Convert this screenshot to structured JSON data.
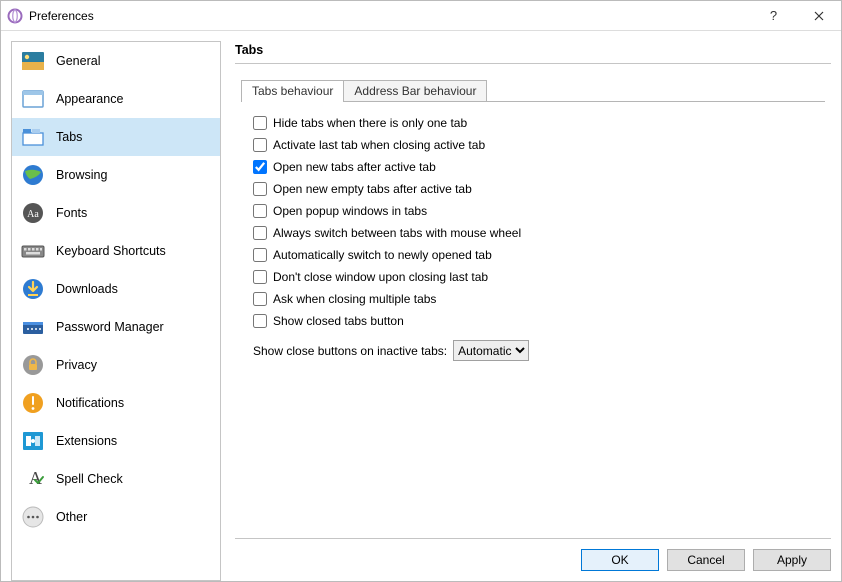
{
  "window": {
    "title": "Preferences"
  },
  "sidebar": {
    "items": [
      {
        "id": "general",
        "label": "General"
      },
      {
        "id": "appearance",
        "label": "Appearance"
      },
      {
        "id": "tabs",
        "label": "Tabs"
      },
      {
        "id": "browsing",
        "label": "Browsing"
      },
      {
        "id": "fonts",
        "label": "Fonts"
      },
      {
        "id": "shortcuts",
        "label": "Keyboard Shortcuts"
      },
      {
        "id": "downloads",
        "label": "Downloads"
      },
      {
        "id": "password",
        "label": "Password Manager"
      },
      {
        "id": "privacy",
        "label": "Privacy"
      },
      {
        "id": "notifications",
        "label": "Notifications"
      },
      {
        "id": "extensions",
        "label": "Extensions"
      },
      {
        "id": "spellcheck",
        "label": "Spell Check"
      },
      {
        "id": "other",
        "label": "Other"
      }
    ],
    "selected": "tabs"
  },
  "main": {
    "heading": "Tabs",
    "tabs": [
      {
        "id": "tabs-behaviour",
        "label": "Tabs behaviour",
        "active": true
      },
      {
        "id": "address-behaviour",
        "label": "Address Bar behaviour",
        "active": false
      }
    ],
    "options": [
      {
        "id": "hideTabs",
        "label": "Hide tabs when there is only one tab",
        "checked": false
      },
      {
        "id": "activateLast",
        "label": "Activate last tab when closing active tab",
        "checked": false
      },
      {
        "id": "openAfter",
        "label": "Open new tabs after active tab",
        "checked": true
      },
      {
        "id": "openEmpty",
        "label": "Open new empty tabs after active tab",
        "checked": false
      },
      {
        "id": "popup",
        "label": "Open popup windows in tabs",
        "checked": false
      },
      {
        "id": "wheelSwitch",
        "label": "Always switch between tabs with mouse wheel",
        "checked": false
      },
      {
        "id": "autoSwitch",
        "label": "Automatically switch to newly opened tab",
        "checked": false
      },
      {
        "id": "dontClose",
        "label": "Don't close window upon closing last tab",
        "checked": false
      },
      {
        "id": "askClose",
        "label": "Ask when closing multiple tabs",
        "checked": false
      },
      {
        "id": "showClosed",
        "label": "Show closed tabs button",
        "checked": false
      }
    ],
    "closeButtons": {
      "label": "Show close buttons on inactive tabs:",
      "value": "Automatic"
    }
  },
  "footer": {
    "ok": "OK",
    "cancel": "Cancel",
    "apply": "Apply"
  }
}
